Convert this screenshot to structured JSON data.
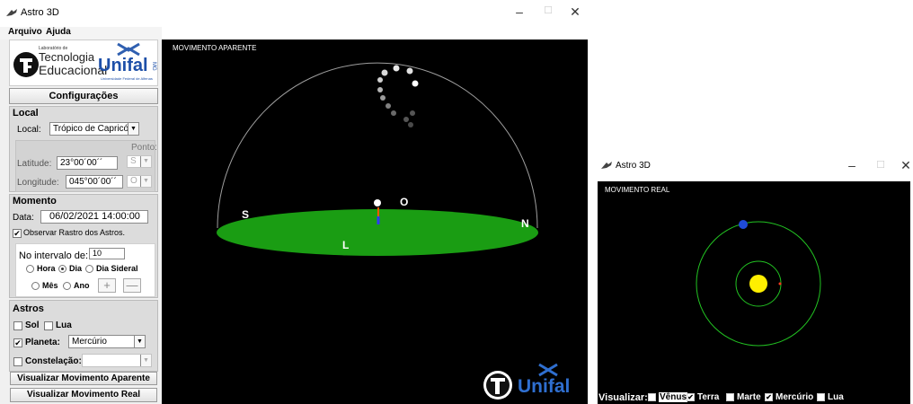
{
  "main_window": {
    "title": "Astro 3D",
    "controls": {
      "minimize": "–",
      "maximize": "☐",
      "close": "✕"
    },
    "menu": [
      "Arquivo",
      "Ajuda"
    ]
  },
  "logo": {
    "line_small": "Laboratório de",
    "line1": "Tecnologia",
    "line2": "Educacional",
    "brand": "Unifal",
    "brand_sub": "Universidade Federal de Alfenas",
    "side": "MG"
  },
  "config": {
    "header": "Configurações",
    "local": {
      "title": "Local",
      "label": "Local:",
      "value": "Trópico de Capricór...",
      "ponto_label": "Ponto:",
      "latitude_label": "Latitude:",
      "latitude_value": "23°00´00´´",
      "lat_dir": "S",
      "longitude_label": "Longitude:",
      "longitude_value": "045°00´00´´",
      "lon_dir": "O"
    },
    "momento": {
      "title": "Momento",
      "date_label": "Data:",
      "date_value": "06/02/2021 14:00:00",
      "trail_label": "Observar Rastro dos Astros.",
      "trail_checked": true,
      "interval_label": "No intervalo de:",
      "interval_value": "10",
      "units": [
        {
          "label": "Hora",
          "selected": false
        },
        {
          "label": "Dia",
          "selected": true
        },
        {
          "label": "Dia Sideral",
          "selected": false
        },
        {
          "label": "Mês",
          "selected": false
        },
        {
          "label": "Ano",
          "selected": false
        }
      ],
      "plus": "+",
      "minus": "—"
    },
    "astros": {
      "title": "Astros",
      "sol": "Sol",
      "lua": "Lua",
      "planeta_label": "Planeta:",
      "planeta_value": "Mercúrio",
      "planeta_checked": true,
      "constelacao_label": "Constelação:",
      "constelacao_value": ""
    },
    "btn_aparente": "Visualizar Movimento Aparente",
    "btn_real": "Visualizar Movimento Real"
  },
  "apparent_view": {
    "label": "MOVIMENTO APARENTE",
    "cardinal": {
      "S": "S",
      "N": "N",
      "L": "L",
      "O": "O"
    },
    "colors": {
      "ground": "#1a9d13",
      "sky": "#000000",
      "dome": "#9e9e9e"
    }
  },
  "second_window": {
    "title": "Astro 3D",
    "controls": {
      "minimize": "–",
      "maximize": "☐",
      "close": "✕"
    },
    "label": "MOVIMENTO REAL",
    "orbit_color": "#22c322",
    "sun_color": "#ffef00",
    "earth_color": "#1f4bd8",
    "mercury_color": "#ff3b1f",
    "viz_label": "Visualizar:",
    "viz_options": [
      {
        "label": "Vênus",
        "checked": false
      },
      {
        "label": "Terra",
        "checked": true
      },
      {
        "label": "Marte",
        "checked": false
      },
      {
        "label": "Mercúrio",
        "checked": true
      },
      {
        "label": "Lua",
        "checked": false
      }
    ]
  }
}
